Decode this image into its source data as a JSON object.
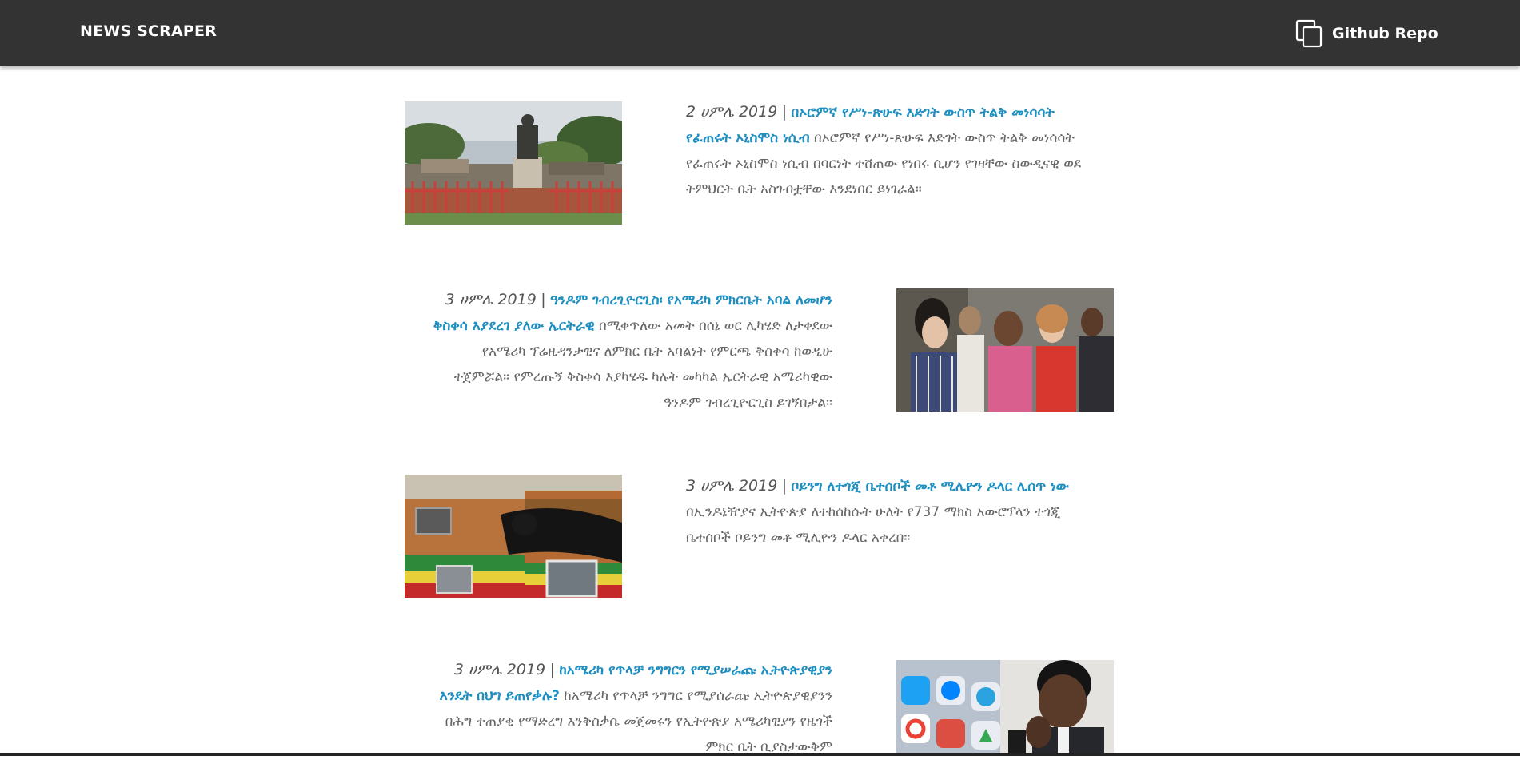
{
  "navbar": {
    "brand": "NEWS SCRAPER",
    "repo_label": "Github Repo",
    "repo_icon": "copy-icon"
  },
  "articles": [
    {
      "date": "2 ሀምሌ 2019",
      "separator": "|",
      "headline": "በኦሮምኛ የሥነ-ጽሁፍ እድገት ውስጥ ትልቅ መነሳሳት የፈጠሩት ኦኒስሞስ ነሲብ",
      "summary": "በኦሮምኛ የሥነ-ጽሁፍ እድገት ውስጥ ትልቅ መነሳሳት የፈጠሩት ኦኒስሞስ ነሲብ በባርነት ተሸጠው የነበሩ ሲሆን የገዛቸው ስውዲናዊ ወደ ትምህርት ቤት አስገብቷቸው እንደነበር ይነገራል።",
      "image": "statue-photo"
    },
    {
      "date": "3 ሀምሌ 2019",
      "separator": "|",
      "headline": "ዓንዶም ገብረጊዮርጊስ፡ የአሜሪካ ምክርቤት አባል ለመሆን ቅስቀሳ እያደረገ ያለው ኤርትራዊ",
      "summary": "በሚቀጥለው አመት በሰኔ ወር ሊካሄድ ለታቀደው የአሜሪካ ፕሬዚዳንታዊና ለምክር ቤት አባልነት የምርጫ ቅስቀሳ ከወዲሁ ተጀምሯል። የምረጡኝ ቅስቀሳ እያካሄዱ ካሉት መካካል ኤርትራዊ አሜሪካዊው ዓንዶም ገብረጊዮርጊስ ይገኝበታል።",
      "image": "crowd-photo"
    },
    {
      "date": "3 ሀምሌ 2019",
      "separator": "|",
      "headline": "ቦይንግ ለተጎጂ ቤተሰቦች መቶ ሚሊዮን ዶላር ሊሰጥ ነው",
      "summary": "በኢንዶኔዥያና ኢትዮጵያ ለተከሰከሱት ሁለት የ737 ማክስ አውሮፕላን ተጎጂ ቤተሰቦች ቦይንግ መቶ ሚሊዮን ዶላር አቀረበ።",
      "image": "caskets-photo"
    },
    {
      "date": "3 ሀምሌ 2019",
      "separator": "|",
      "headline": "ከአሜሪካ የጥላቻ ንግግርን የሚያሠራጩ ኢትዮጵያዊያን እንዴት በህግ ይጠየቃሉ?",
      "summary": "ከአሜሪካ የጥላቻ ንግግር የሚያሰራጩ ኢትዮጵያዊያንን በሕግ ተጠያቂ የማድረግ እንቅስቃሴ መጀመሩን የኢትዮጵያ አሜሪካዊያን የዜጎች ምክር ቤት ቢያስታውቅም",
      "image": "social-apps-photo"
    }
  ],
  "colors": {
    "navbar_bg": "#333333",
    "headline": "#1e8fc0",
    "body_text": "#666666"
  }
}
